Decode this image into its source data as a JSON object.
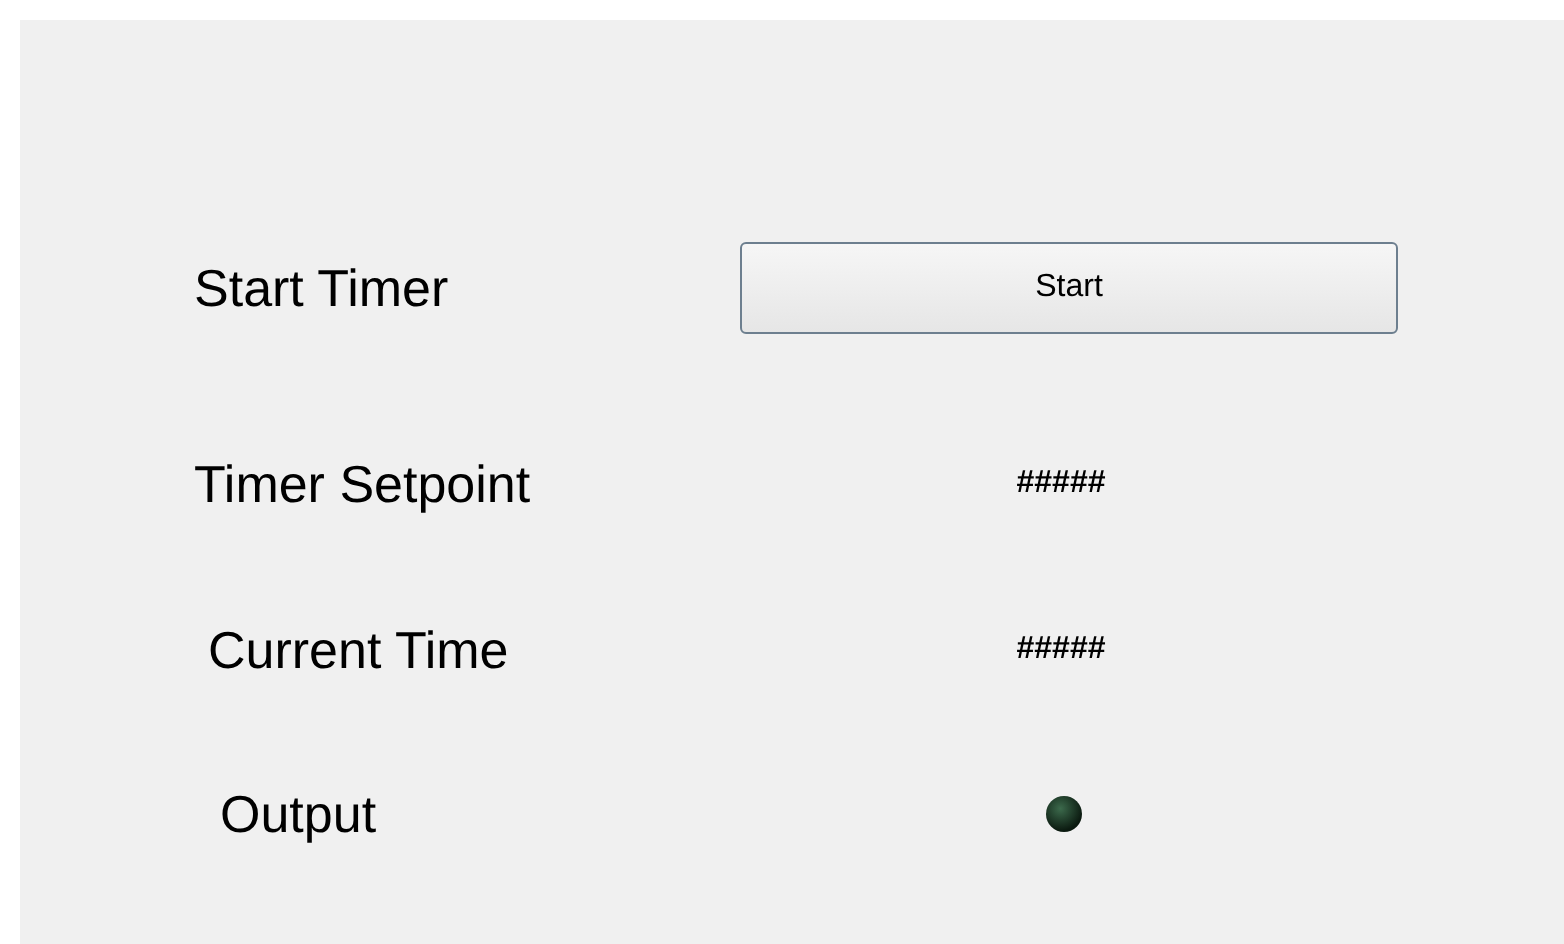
{
  "rows": [
    {
      "label": "Start Timer",
      "kind": "button",
      "button": "Start"
    },
    {
      "label": "Timer Setpoint",
      "kind": "value",
      "value": "#####"
    },
    {
      "label": "Current Time",
      "kind": "value",
      "value": "#####"
    },
    {
      "label": "Output",
      "kind": "led",
      "on": false
    }
  ]
}
